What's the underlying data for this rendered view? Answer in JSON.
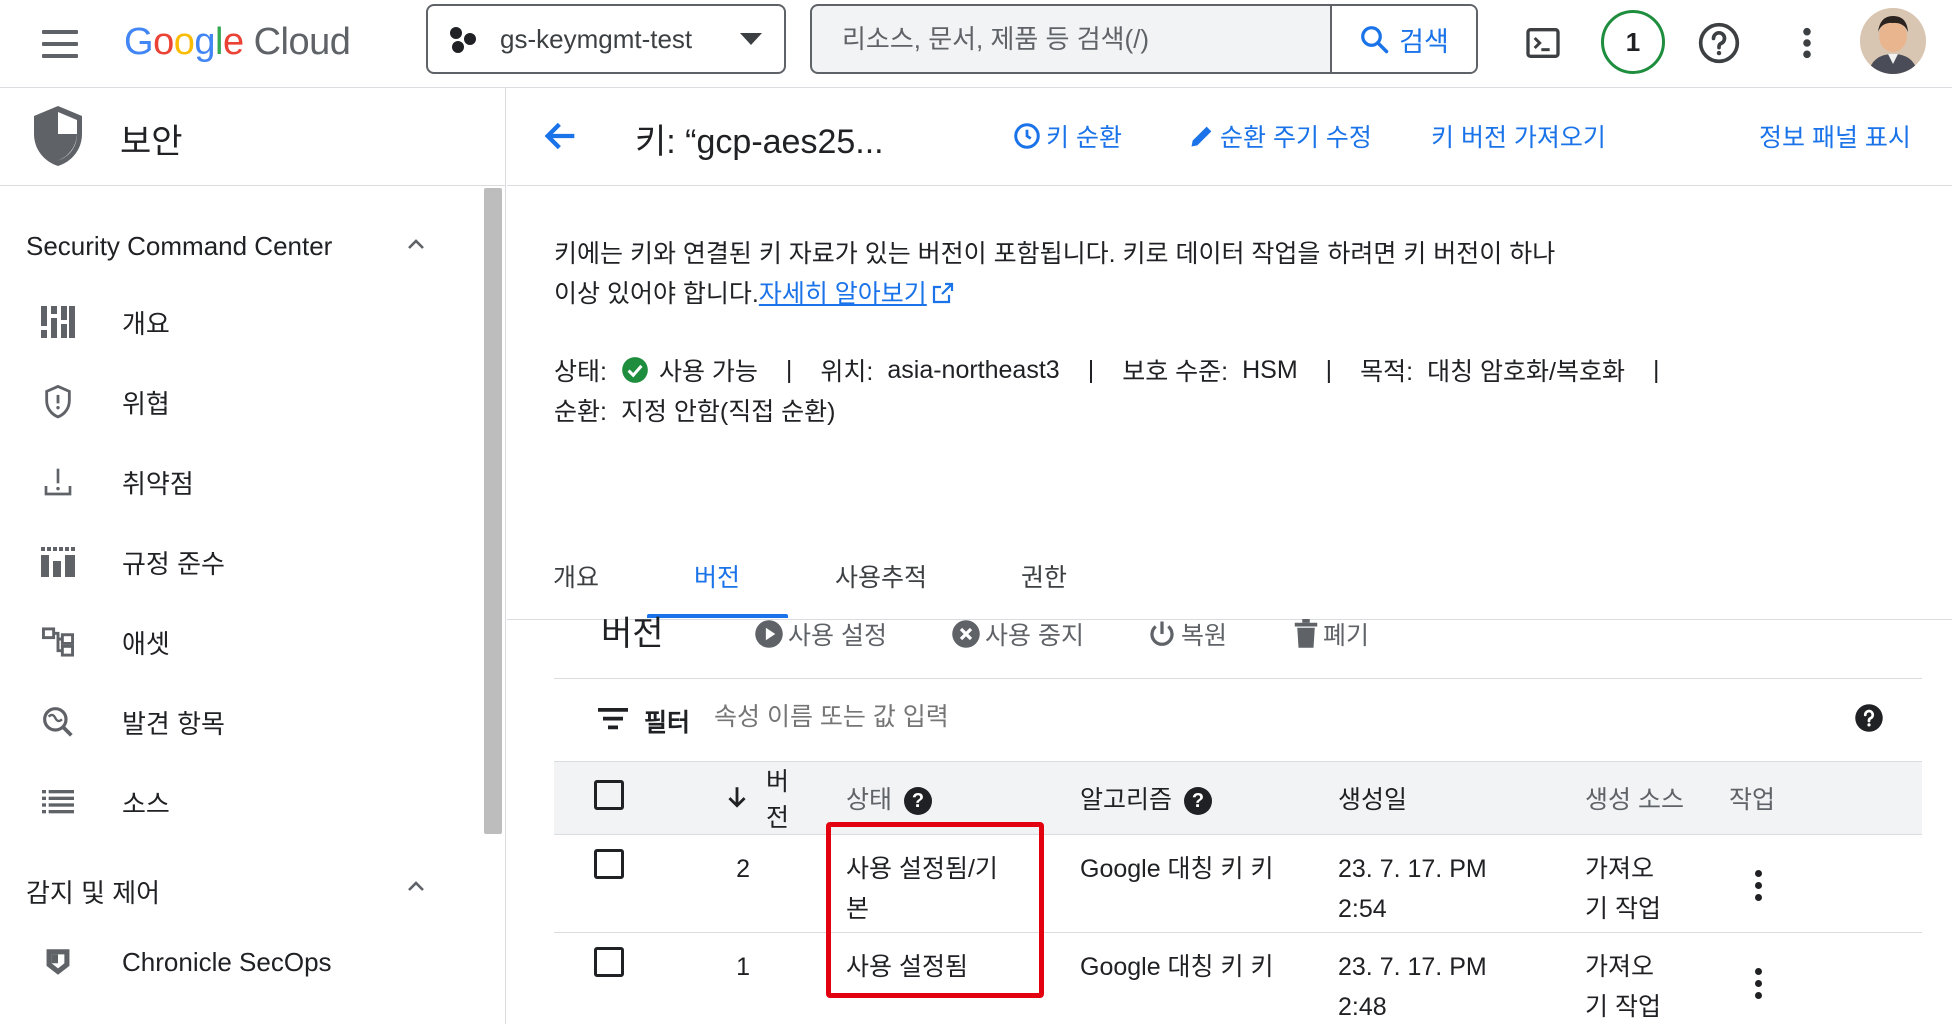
{
  "header": {
    "logo_google": [
      "G",
      "o",
      "o",
      "g",
      "l",
      "e"
    ],
    "logo_cloud": "Cloud",
    "project_name": "gs-keymgmt-test",
    "search_placeholder": "리소스, 문서, 제품 등 검색(/)",
    "search_button": "검색",
    "notification_count": "1",
    "icons": [
      "menu-icon",
      "cloud-shell-icon",
      "help-icon",
      "more-vert-icon",
      "avatar"
    ]
  },
  "sidebar": {
    "title": "보안",
    "sections": [
      {
        "label": "Security Command Center",
        "items": [
          {
            "label": "개요",
            "icon": "dashboard-icon"
          },
          {
            "label": "위협",
            "icon": "threat-shield-icon"
          },
          {
            "label": "취약점",
            "icon": "vulnerability-icon"
          },
          {
            "label": "규정 준수",
            "icon": "compliance-icon"
          },
          {
            "label": "애셋",
            "icon": "asset-icon"
          },
          {
            "label": "발견 항목",
            "icon": "findings-icon"
          },
          {
            "label": "소스",
            "icon": "sources-icon"
          }
        ]
      },
      {
        "label": "감지 및 제어",
        "items": [
          {
            "label": "Chronicle SecOps",
            "icon": "chronicle-icon"
          }
        ]
      }
    ]
  },
  "page": {
    "title": "키: “gcp-aes25...",
    "actions": {
      "rotate": "키 순환",
      "edit_rotation": "순환 주기 수정",
      "import_version": "키 버전 가져오기",
      "info_panel": "정보 패널 표시"
    },
    "description": "키에는 키와 연결된 키 자료가 있는 버전이 포함됩니다. 키로 데이터 작업을 하려면 키 버전이 하나 이상 있어야 합니다.",
    "learn_more": "자세히 알아보기",
    "meta": {
      "status_label": "상태:",
      "status_value": "사용 가능",
      "location_label": "위치:",
      "location_value": "asia-northeast3",
      "protection_label": "보호 수준:",
      "protection_value": "HSM",
      "purpose_label": "목적:",
      "purpose_value": "대칭 암호화/복호화",
      "rotation_label": "순환:",
      "rotation_value": "지정 안함(직접 순환)",
      "separator": "|"
    },
    "tabs": [
      "개요",
      "버전",
      "사용추적",
      "권한"
    ],
    "active_tab": "버전"
  },
  "versions": {
    "title": "버전",
    "actions": {
      "enable": "사용 설정",
      "disable": "사용 중지",
      "restore": "복원",
      "destroy": "폐기"
    },
    "filter_label": "필터",
    "filter_placeholder": "속성 이름 또는 값 입력",
    "columns": {
      "version": "버전",
      "status": "상태",
      "algorithm": "알고리즘",
      "created": "생성일",
      "source": "생성 소스",
      "actions": "작업"
    },
    "rows": [
      {
        "version": "2",
        "status": "사용 설정됨/기본",
        "algorithm": "Google 대칭 키 키",
        "created": "23. 7. 17. PM 2:54",
        "source": "가져오기 작업"
      },
      {
        "version": "1",
        "status": "사용 설정됨",
        "algorithm": "Google 대칭 키 키",
        "created": "23. 7. 17. PM 2:48",
        "source": "가져오기 작업"
      }
    ]
  },
  "colors": {
    "accent": "#1a73e8",
    "status_ok": "#1e8e3e",
    "highlight": "#e3000f"
  }
}
